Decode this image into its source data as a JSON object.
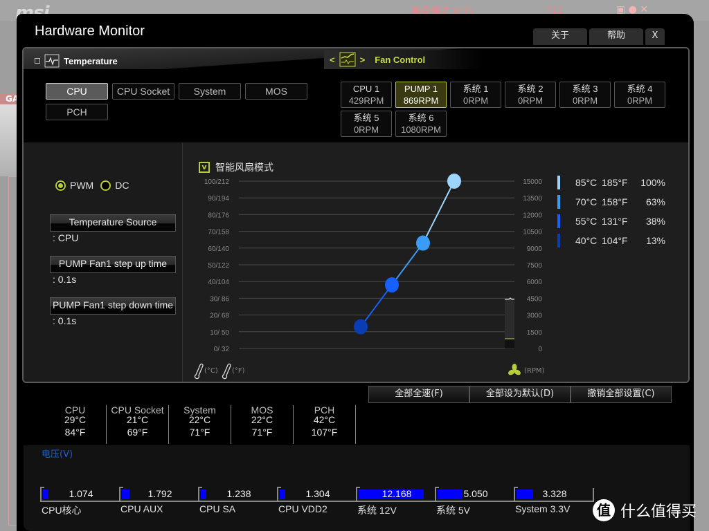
{
  "background": {
    "logo": "msi",
    "mode_label": "高级模式 (F7)",
    "f12_label": "F12",
    "left_tab": "GA"
  },
  "window": {
    "title": "Hardware Monitor",
    "buttons": {
      "about": "关于",
      "help": "帮助",
      "close": "X"
    }
  },
  "panel": {
    "temperature_tab": "Temperature",
    "fan_control_tab": "Fan Control",
    "fan_nav_prev": "<",
    "fan_nav_next": ">",
    "sensors": [
      {
        "label": "CPU",
        "active": true
      },
      {
        "label": "CPU Socket",
        "active": false
      },
      {
        "label": "System",
        "active": false
      },
      {
        "label": "MOS",
        "active": false
      },
      {
        "label": "PCH",
        "active": false
      }
    ],
    "fans": [
      {
        "name": "CPU 1",
        "rpm": "429RPM",
        "active": false
      },
      {
        "name": "PUMP 1",
        "rpm": "869RPM",
        "active": true
      },
      {
        "name": "系统 1",
        "rpm": "0RPM",
        "active": false
      },
      {
        "name": "系统 2",
        "rpm": "0RPM",
        "active": false
      },
      {
        "name": "系统 3",
        "rpm": "0RPM",
        "active": false
      },
      {
        "name": "系统 4",
        "rpm": "0RPM",
        "active": false
      },
      {
        "name": "系统 5",
        "rpm": "0RPM",
        "active": false
      },
      {
        "name": "系统 6",
        "rpm": "1080RPM",
        "active": false
      }
    ]
  },
  "fan_settings": {
    "mode_pwm": "PWM",
    "mode_dc": "DC",
    "mode_selected": "PWM",
    "temp_source_label": "Temperature Source",
    "temp_source_value": ": CPU",
    "step_up_label": "PUMP Fan1 step up time",
    "step_up_value": ": 0.1s",
    "step_down_label": "PUMP Fan1 step down time",
    "step_down_value": ": 0.1s",
    "smart_mode_label": "智能风扇模式",
    "smart_mode_checked": true,
    "smart_mode_check_glyph": "v"
  },
  "chart_data": {
    "type": "line",
    "title": "智能风扇模式",
    "xlabel": "",
    "ylabel_left": "(°C) (°F)",
    "ylabel_right": "(RPM)",
    "left_ticks": [
      "0/  32",
      "10/  50",
      "20/  68",
      "30/  86",
      "40/104",
      "50/122",
      "60/140",
      "70/158",
      "80/176",
      "90/194",
      "100/212"
    ],
    "right_ticks": [
      "0",
      "1500",
      "3000",
      "4500",
      "6000",
      "7500",
      "9000",
      "10500",
      "12000",
      "13500",
      "15000"
    ],
    "ylim_left": [
      0,
      100
    ],
    "ylim_right": [
      0,
      15000
    ],
    "grid": true,
    "points": [
      {
        "temp_c": 40,
        "temp_f": 104,
        "percent": 13,
        "color": "#0a3cb4"
      },
      {
        "temp_c": 55,
        "temp_f": 131,
        "percent": 38,
        "color": "#1560ff"
      },
      {
        "temp_c": 70,
        "temp_f": 158,
        "percent": 63,
        "color": "#3a9cf5"
      },
      {
        "temp_c": 85,
        "temp_f": 185,
        "percent": 100,
        "color": "#9cd6ff"
      }
    ],
    "current_rpm_indicator": 869,
    "legend_position": "right"
  },
  "legend": [
    {
      "c": "85°C",
      "f": "185°F",
      "p": "100%",
      "color": "#9cd6ff"
    },
    {
      "c": "70°C",
      "f": "158°F",
      "p": "63%",
      "color": "#3a9cf5"
    },
    {
      "c": "55°C",
      "f": "131°F",
      "p": "38%",
      "color": "#1560ff"
    },
    {
      "c": "40°C",
      "f": "104°F",
      "p": "13%",
      "color": "#0a3cb4"
    }
  ],
  "actions": {
    "full_speed": "全部全速(F)",
    "set_default": "全部设为默认(D)",
    "undo_all": "撤销全部设置(C)"
  },
  "temperatures": [
    {
      "name": "CPU",
      "c": "29°C",
      "f": "84°F"
    },
    {
      "name": "CPU Socket",
      "c": "21°C",
      "f": "69°F"
    },
    {
      "name": "System",
      "c": "22°C",
      "f": "71°F"
    },
    {
      "name": "MOS",
      "c": "22°C",
      "f": "71°F"
    },
    {
      "name": "PCH",
      "c": "42°C",
      "f": "107°F"
    }
  ],
  "voltage": {
    "title": "电压(V)",
    "items": [
      {
        "label": "CPU核心",
        "value": "1.074",
        "fill": 0.07
      },
      {
        "label": "CPU AUX",
        "value": "1.792",
        "fill": 0.1
      },
      {
        "label": "CPU SA",
        "value": "1.238",
        "fill": 0.07
      },
      {
        "label": "CPU VDD2",
        "value": "1.304",
        "fill": 0.07
      },
      {
        "label": "系统 12V",
        "value": "12.168",
        "fill": 0.85
      },
      {
        "label": "系统 5V",
        "value": "5.050",
        "fill": 0.33
      },
      {
        "label": "System 3.3V",
        "value": "3.328",
        "fill": 0.22
      }
    ]
  },
  "watermark": {
    "text": "什么值得买",
    "icon_glyph": "值"
  },
  "accent": {
    "lime": "#b9cc3a",
    "voltage_bar": "#0000ff",
    "voltage_title": "#1e5fc8"
  }
}
